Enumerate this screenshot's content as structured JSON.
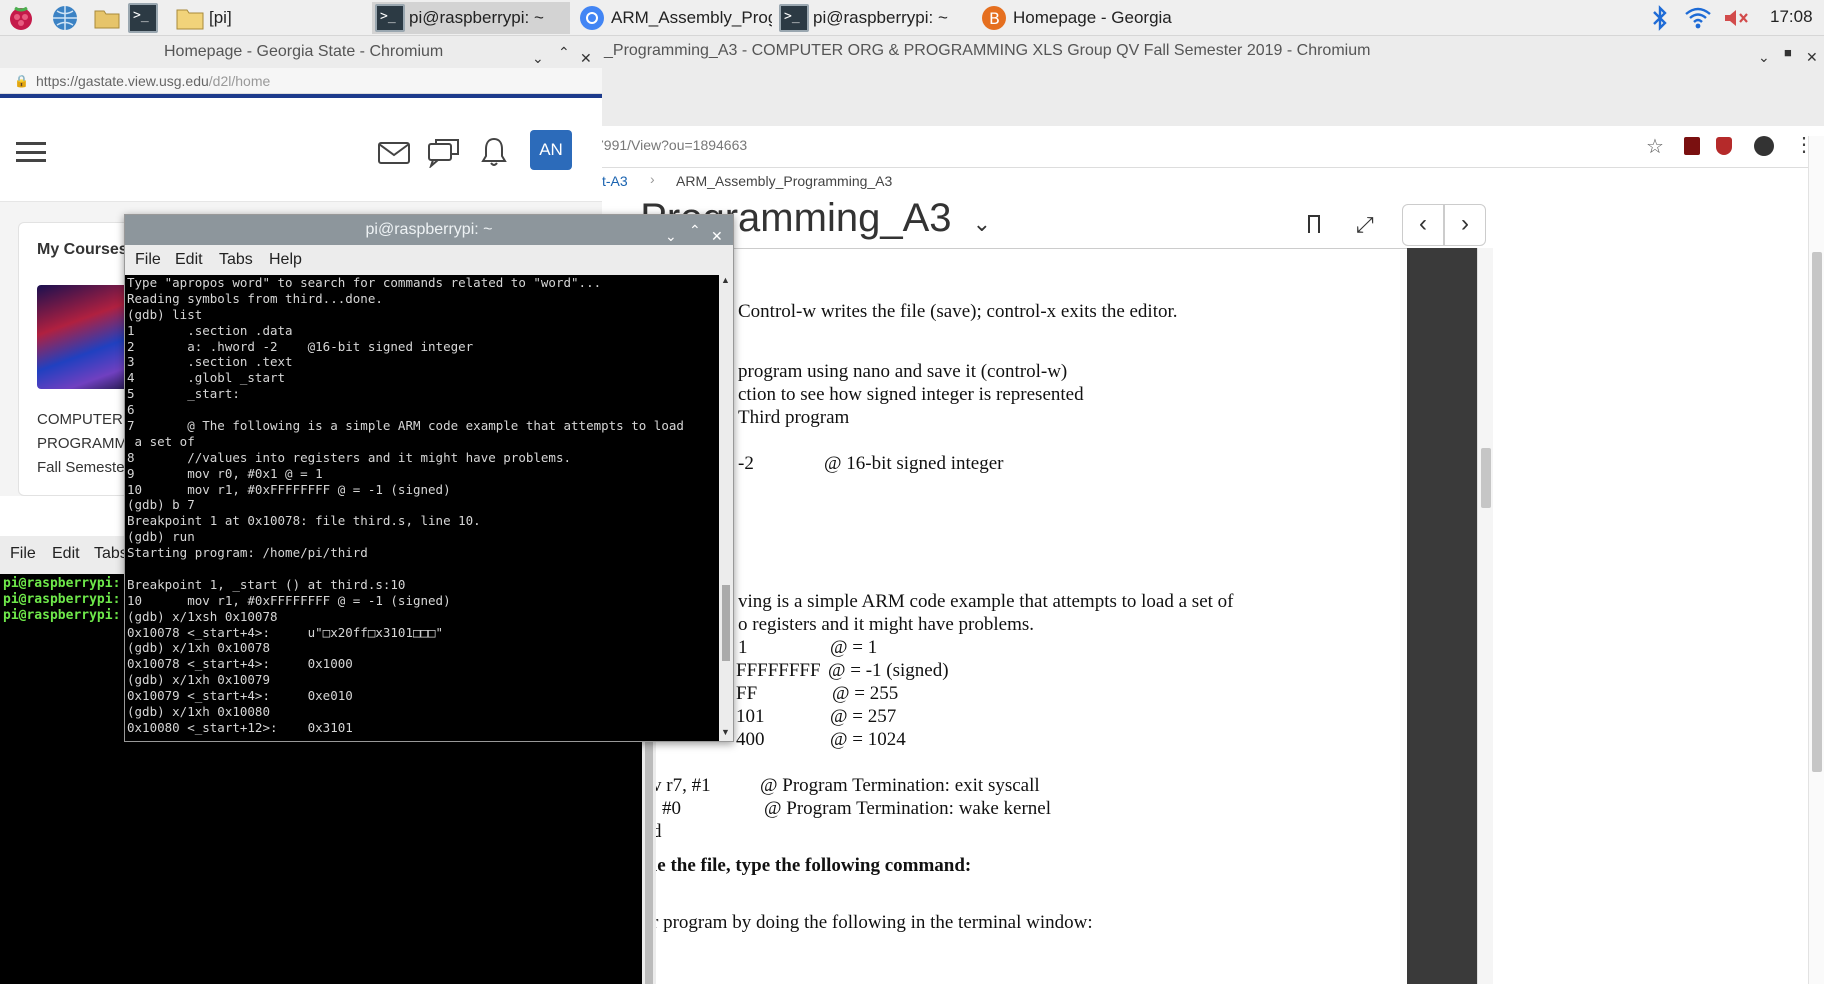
{
  "taskbar": {
    "tasks": [
      {
        "label": "[pi]"
      },
      {
        "label": "pi@raspberrypi: ~"
      },
      {
        "label": "ARM_Assembly_Prog..."
      },
      {
        "label": "pi@raspberrypi: ~"
      },
      {
        "label": "Homepage - Georgia ..."
      }
    ],
    "clock": "17:08"
  },
  "right_browser": {
    "window_title": "_Programming_A3 - COMPUTER ORG & PROGRAMMING XLS Group QV Fall Semester 2019 - Chromium",
    "url": "7991/View?ou=1894663",
    "breadcrumb_parent": "t-A3",
    "breadcrumb_current": "ARM_Assembly_Programming_A3",
    "heading": "_Programming_A3",
    "doc_lines": [
      "Control-w writes the file (save); control-x exits the editor.",
      "program using nano and save it (control-w)",
      "ction to see how signed integer is represented",
      "Third program",
      "-2",
      "@ 16-bit signed integer",
      "ving is a simple ARM code example that attempts to load a set of",
      "o registers and it might have problems.",
      "1",
      "@ = 1",
      "FFFFFFFF",
      "@ = -1 (signed)",
      "FF",
      "@ = 255",
      "101",
      "@ = 257",
      "400",
      "@ = 1024",
      "v r7, #1",
      "@ Program Termination: exit syscall",
      ": #0",
      "@ Program Termination: wake kernel",
      "d",
      "le the file, type the following command:",
      "r program by doing the following in the terminal window:"
    ]
  },
  "left_browser": {
    "window_title": "Homepage - Georgia State - Chromium",
    "url_host": "https://gastate.view.usg.edu",
    "url_path": "/d2l/home",
    "avatar_initials": "AN",
    "my_courses": "My Courses",
    "course_lines": [
      "COMPUTER",
      "PROGRAMM",
      "Fall Semeste"
    ]
  },
  "bottom_terminal": {
    "menu": {
      "file": "File",
      "edit": "Edit",
      "tabs": "Tabs"
    },
    "lines": [
      "pi@raspberrypi:",
      "pi@raspberrypi:",
      "pi@raspberrypi:"
    ]
  },
  "gdb_terminal": {
    "title": "pi@raspberrypi: ~",
    "menu": {
      "file": "File",
      "edit": "Edit",
      "tabs": "Tabs",
      "help": "Help"
    },
    "lines": [
      "Type \"apropos word\" to search for commands related to \"word\"...",
      "Reading symbols from third...done.",
      "(gdb) list",
      "1       .section .data",
      "2       a: .hword -2    @16-bit signed integer",
      "3       .section .text",
      "4       .globl _start",
      "5       _start:",
      "6",
      "7       @ The following is a simple ARM code example that attempts to load",
      " a set of",
      "8       //values into registers and it might have problems.",
      "9       mov r0, #0x1 @ = 1",
      "10      mov r1, #0xFFFFFFFF @ = -1 (signed)",
      "(gdb) b 7",
      "Breakpoint 1 at 0x10078: file third.s, line 10.",
      "(gdb) run",
      "Starting program: /home/pi/third",
      "",
      "Breakpoint 1, _start () at third.s:10",
      "10      mov r1, #0xFFFFFFFF @ = -1 (signed)",
      "(gdb) x/1xsh 0x10078",
      "0x10078 <_start+4>:     u\"□x20ff□x3101□□□\"",
      "(gdb) x/1xh 0x10078",
      "0x10078 <_start+4>:     0x1000",
      "(gdb) x/1xh 0x10079",
      "0x10079 <_start+4>:     0xe010",
      "(gdb) x/1xh 0x10080",
      "0x10080 <_start+12>:    0x3101"
    ]
  }
}
